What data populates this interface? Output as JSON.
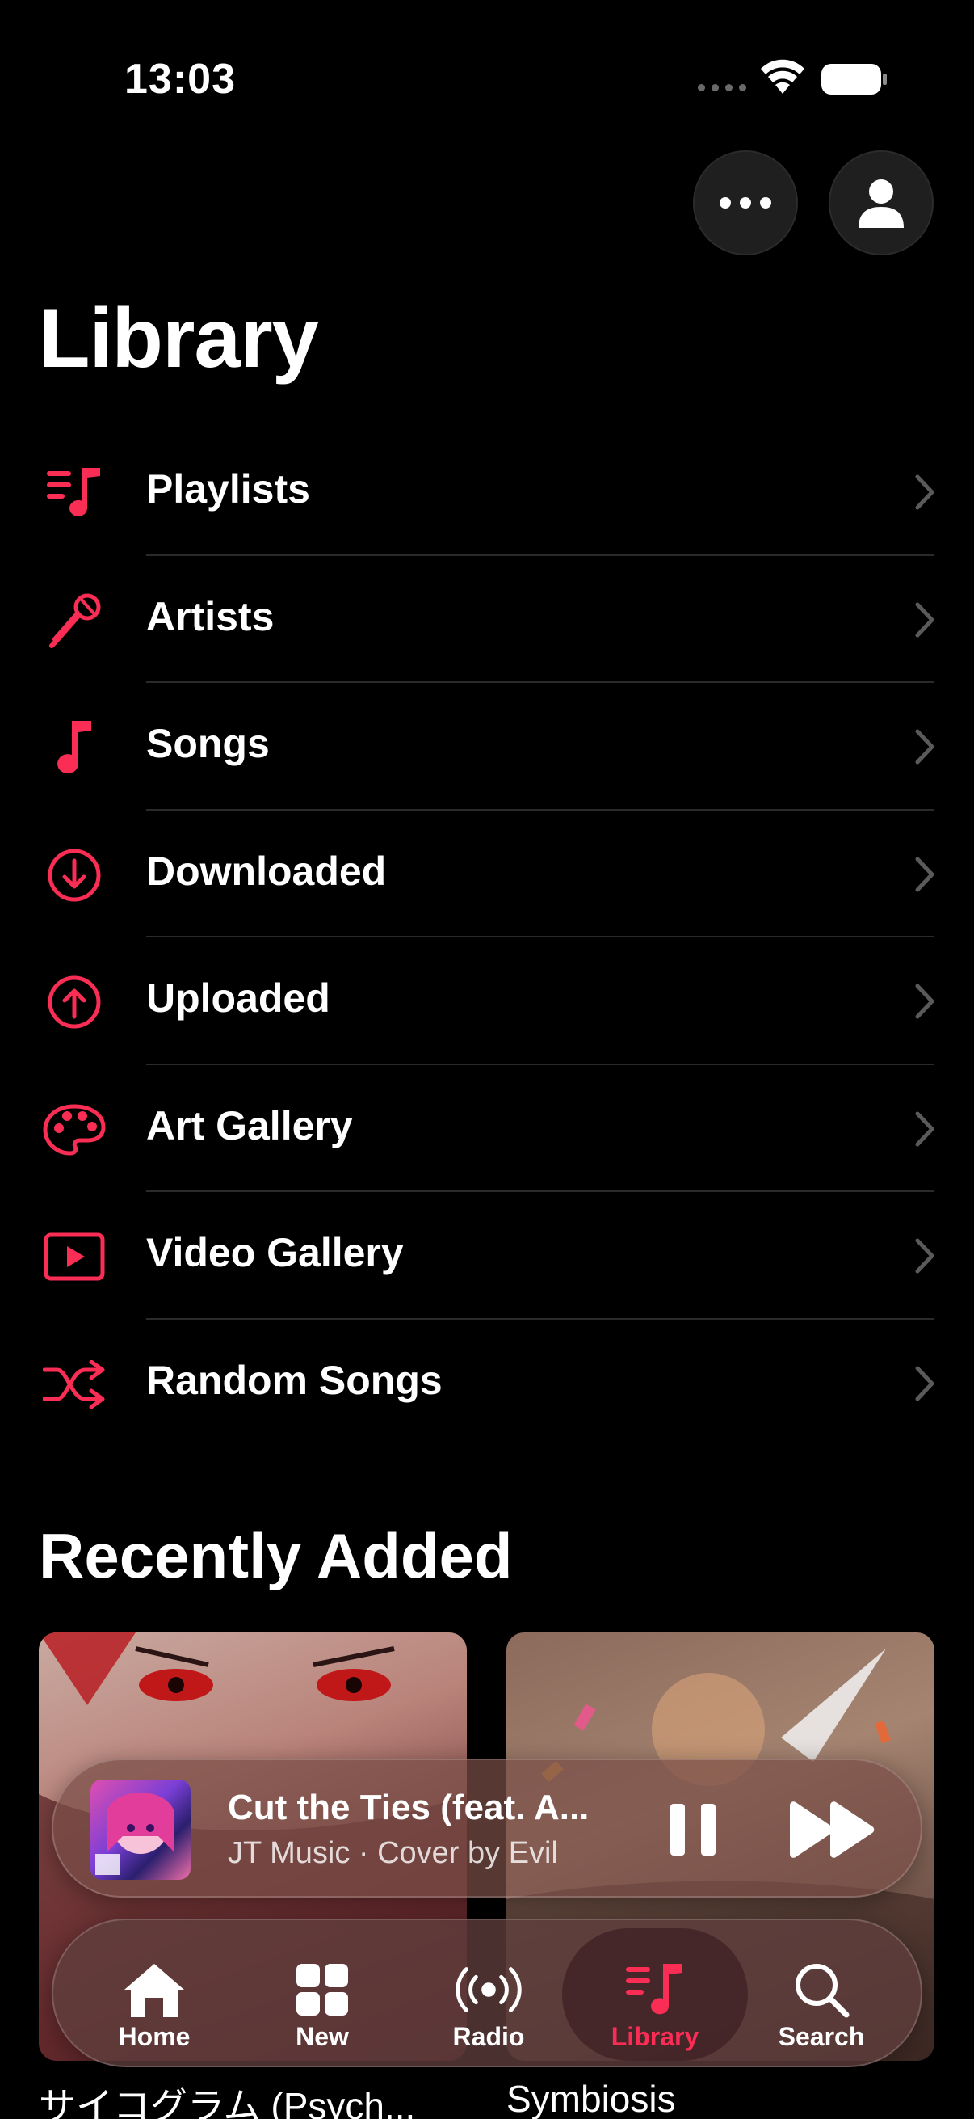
{
  "status_bar": {
    "time": "13:03"
  },
  "header": {
    "title": "Library",
    "more_icon": "ellipsis-icon",
    "account_icon": "person-icon"
  },
  "library_items": [
    {
      "label": "Playlists",
      "icon": "playlist-icon"
    },
    {
      "label": "Artists",
      "icon": "microphone-icon"
    },
    {
      "label": "Songs",
      "icon": "music-note-icon"
    },
    {
      "label": "Downloaded",
      "icon": "download-circle-icon"
    },
    {
      "label": "Uploaded",
      "icon": "upload-circle-icon"
    },
    {
      "label": "Art Gallery",
      "icon": "palette-icon"
    },
    {
      "label": "Video Gallery",
      "icon": "play-rectangle-icon"
    },
    {
      "label": "Random Songs",
      "icon": "shuffle-icon"
    }
  ],
  "recently_added": {
    "title": "Recently Added",
    "albums": [
      {
        "title": "サイコグラム (Psych..."
      },
      {
        "title": "Symbiosis"
      }
    ]
  },
  "now_playing": {
    "title": "Cut the Ties (feat. A...",
    "subtitle": "JT Music · Cover by Evil"
  },
  "tabs": [
    {
      "label": "Home",
      "icon": "house-icon",
      "active": false
    },
    {
      "label": "New",
      "icon": "grid-icon",
      "active": false
    },
    {
      "label": "Radio",
      "icon": "broadcast-icon",
      "active": false
    },
    {
      "label": "Library",
      "icon": "library-icon",
      "active": true
    },
    {
      "label": "Search",
      "icon": "magnifier-icon",
      "active": false
    }
  ],
  "colors": {
    "accent": "#fa2d55",
    "background": "#000000",
    "divider": "#2a2a2a",
    "chevron": "#5a5a5a"
  }
}
